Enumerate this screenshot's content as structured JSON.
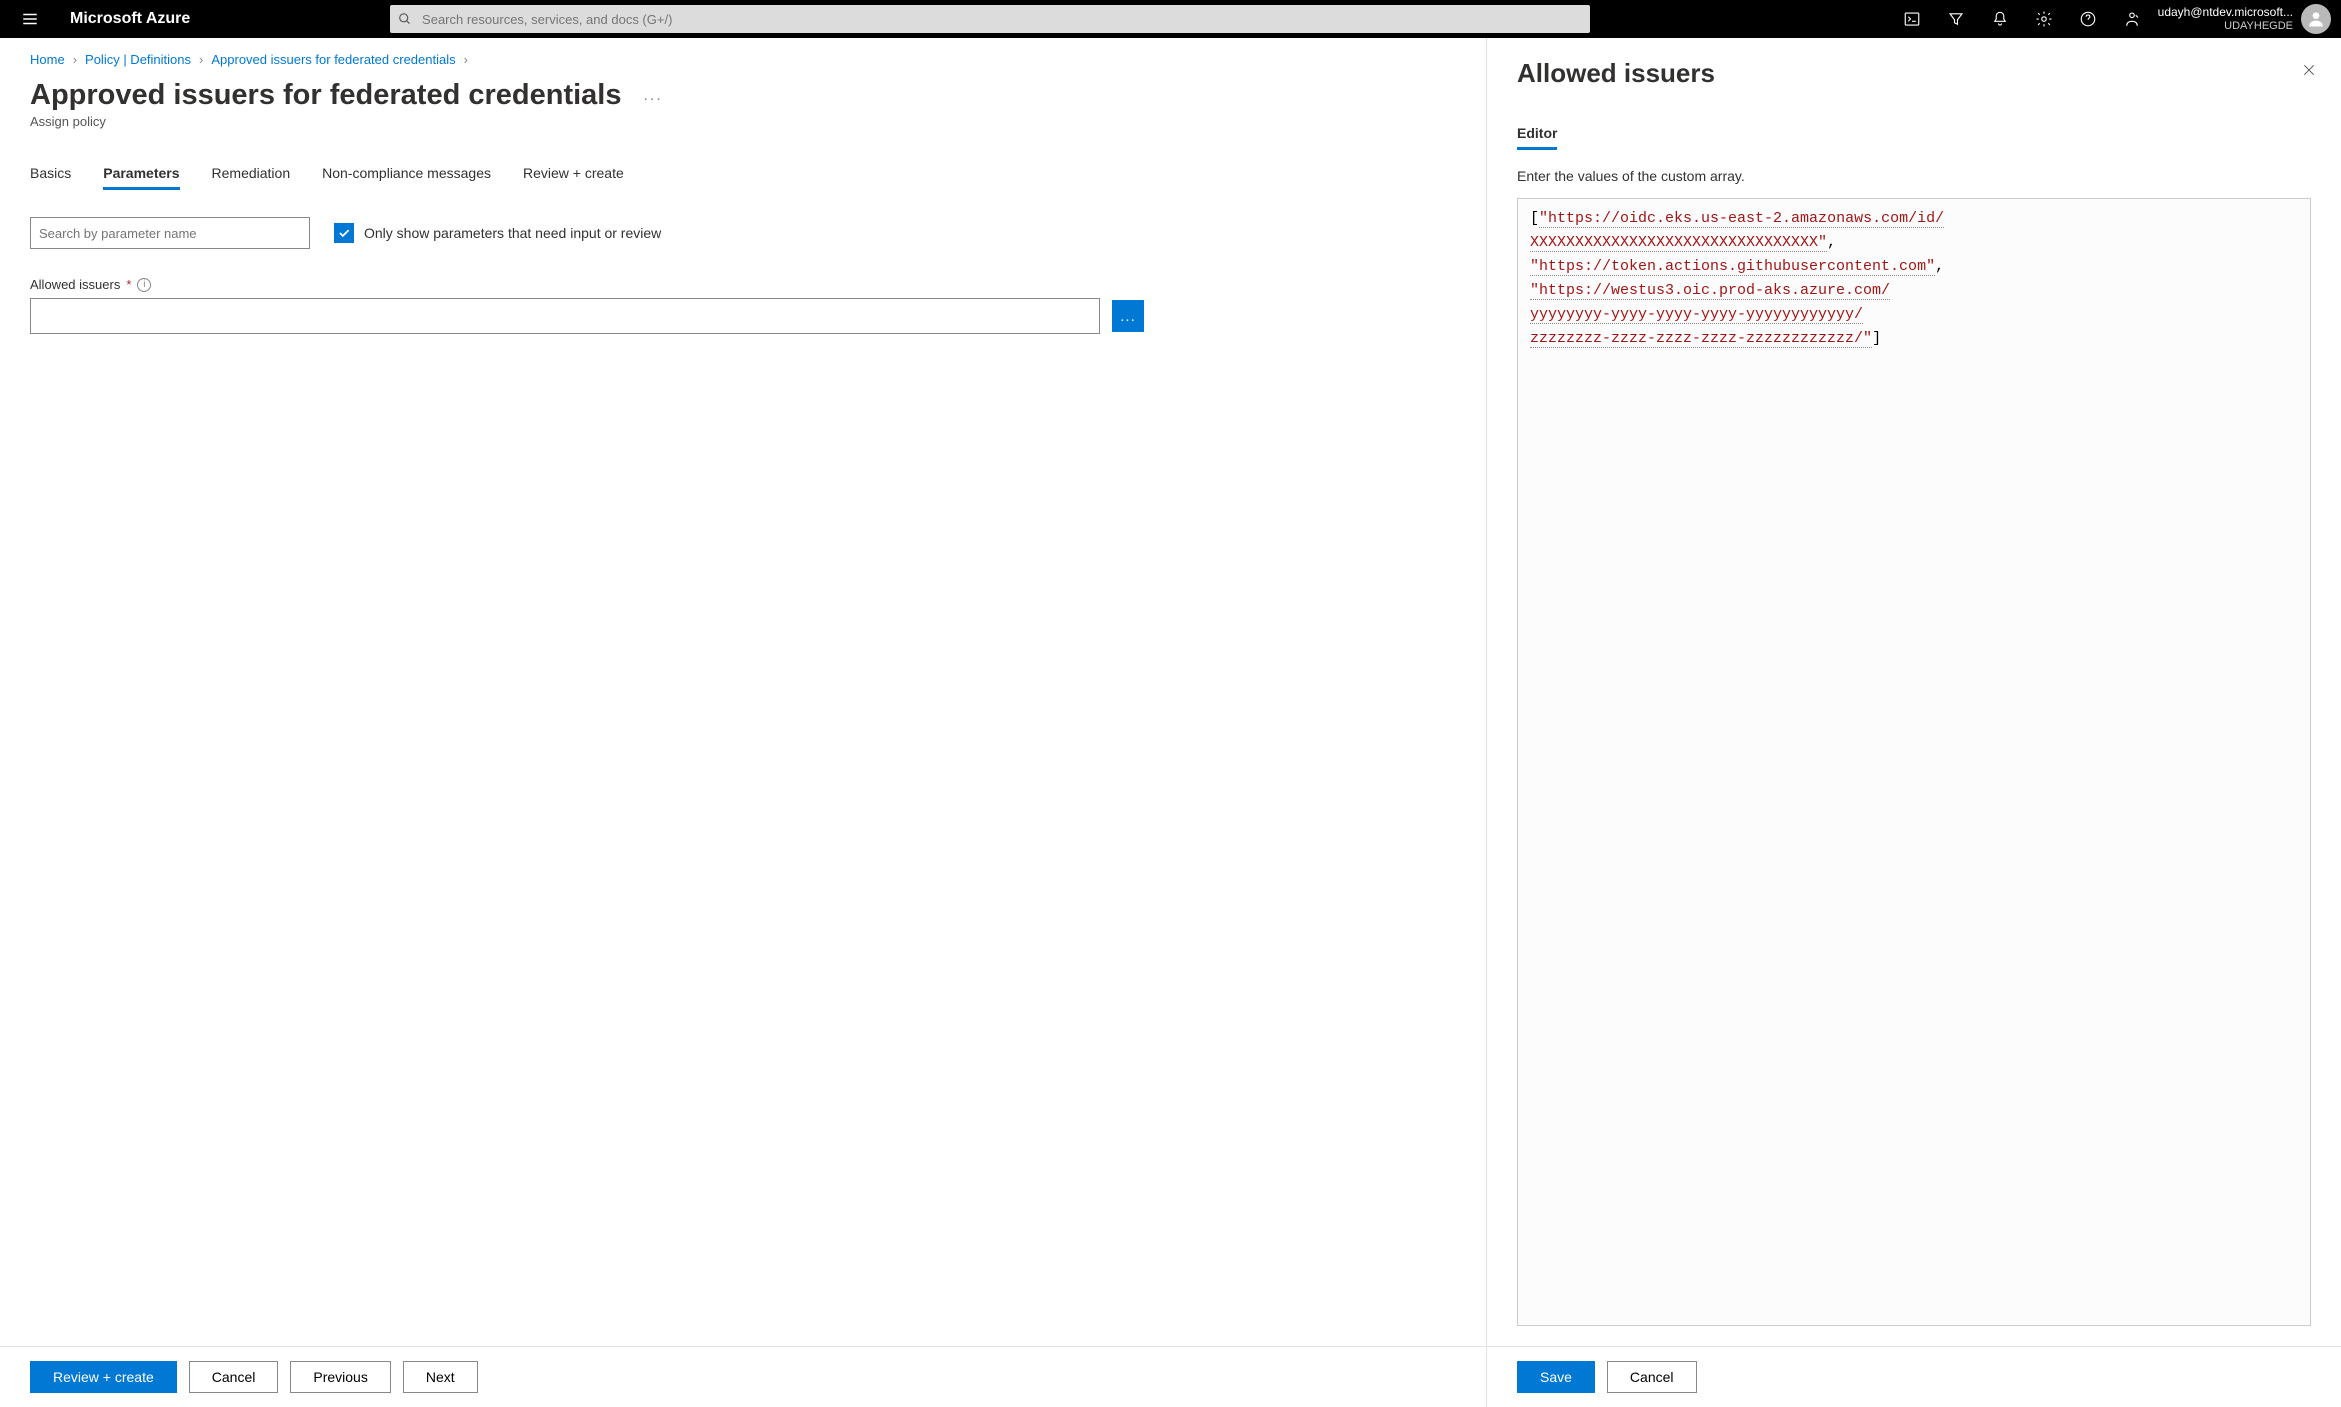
{
  "topbar": {
    "brand": "Microsoft Azure",
    "search_placeholder": "Search resources, services, and docs (G+/)",
    "account_email": "udayh@ntdev.microsoft...",
    "account_tenant": "UDAYHEGDE"
  },
  "breadcrumb": {
    "items": [
      "Home",
      "Policy | Definitions",
      "Approved issuers for federated credentials"
    ]
  },
  "page": {
    "title": "Approved issuers for federated credentials",
    "subtitle": "Assign policy",
    "more_label": "..."
  },
  "tabs": {
    "items": [
      "Basics",
      "Parameters",
      "Remediation",
      "Non-compliance messages",
      "Review + create"
    ],
    "active_index": 1
  },
  "filters": {
    "search_placeholder": "Search by parameter name",
    "checkbox_label": "Only show parameters that need input or review",
    "checkbox_checked": true
  },
  "field": {
    "label": "Allowed issuers",
    "required": "*",
    "value": "",
    "more_btn": "..."
  },
  "footer": {
    "review_create": "Review + create",
    "cancel": "Cancel",
    "previous": "Previous",
    "next": "Next"
  },
  "side_panel": {
    "title": "Allowed issuers",
    "tab": "Editor",
    "hint": "Enter the values of the custom array.",
    "editor_prefix": "[",
    "editor_str1_a": "\"https://oidc.eks.us-east-2.amazonaws.com/id/",
    "editor_str1_b": "XXXXXXXXXXXXXXXXXXXXXXXXXXXXXXXX\"",
    "editor_sep1": ",",
    "editor_str2": "\"https://token.actions.githubusercontent.com\"",
    "editor_sep2": ",",
    "editor_str3_a": "\"https://westus3.oic.prod-aks.azure.com/",
    "editor_str3_b": "yyyyyyyy-yyyy-yyyy-yyyy-yyyyyyyyyyyy/",
    "editor_str3_c": "zzzzzzzz-zzzz-zzzz-zzzz-zzzzzzzzzzzz/\"",
    "editor_suffix": "]",
    "save": "Save",
    "cancel": "Cancel"
  }
}
